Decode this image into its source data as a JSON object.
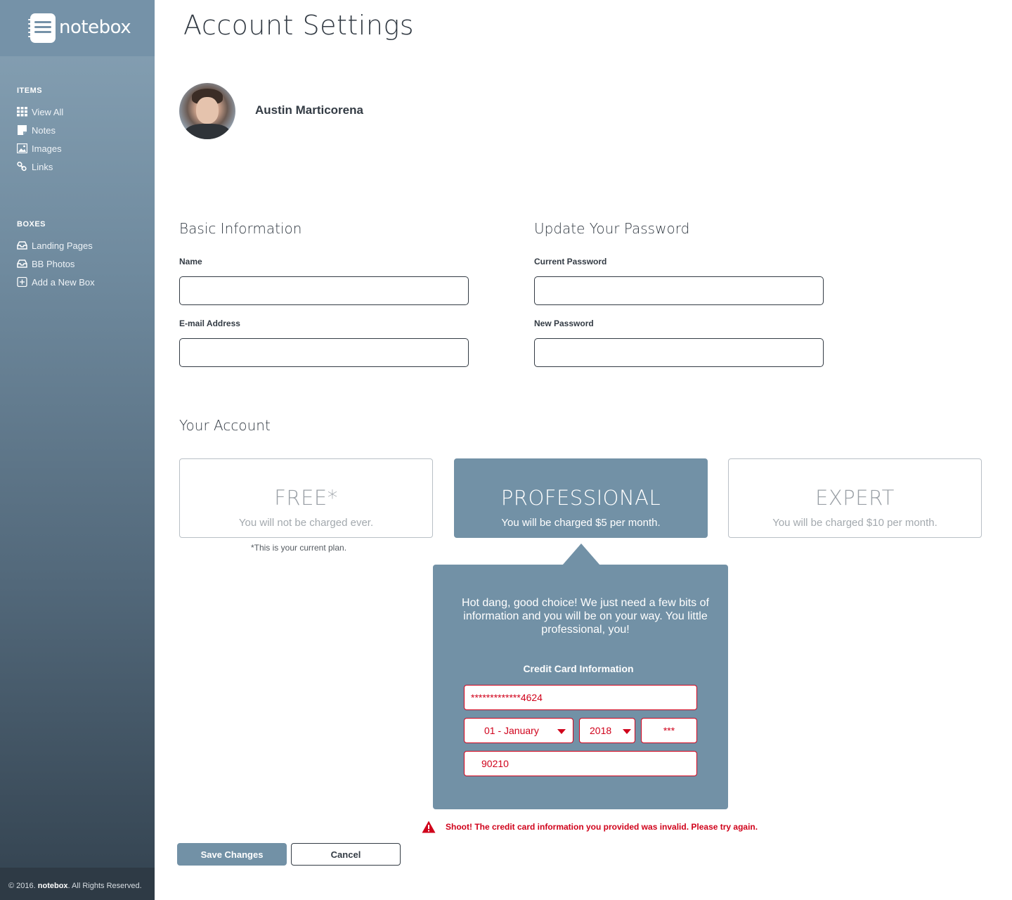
{
  "app": {
    "logo_text": "notebox",
    "page_title": "Account Settings"
  },
  "sidebar": {
    "items_heading": "ITEMS",
    "items": [
      {
        "label": "View All",
        "icon": "grid-icon"
      },
      {
        "label": "Notes",
        "icon": "note-icon"
      },
      {
        "label": "Images",
        "icon": "image-icon"
      },
      {
        "label": "Links",
        "icon": "link-icon"
      }
    ],
    "boxes_heading": "BOXES",
    "boxes": [
      {
        "label": "Landing Pages",
        "icon": "inbox-icon"
      },
      {
        "label": "BB Photos",
        "icon": "inbox-icon"
      },
      {
        "label": "Add a New Box",
        "icon": "plus-square-icon"
      }
    ],
    "footer": {
      "prefix": "© 2016.",
      "brand": "notebox",
      "suffix": ". All Rights Reserved."
    }
  },
  "profile": {
    "name": "Austin Marticorena"
  },
  "basic_info": {
    "title": "Basic Information",
    "name_label": "Name",
    "name_value": "",
    "email_label": "E-mail Address",
    "email_value": ""
  },
  "password": {
    "title": "Update Your Password",
    "current_label": "Current Password",
    "current_value": "",
    "new_label": "New Password",
    "new_value": ""
  },
  "account": {
    "title": "Your Account",
    "plans": [
      {
        "name": "FREE*",
        "description": "You will not be charged ever.",
        "selected": false
      },
      {
        "name": "PROFESSIONAL",
        "description": "You will be charged $5 per month.",
        "selected": true
      },
      {
        "name": "EXPERT",
        "description": "You will be charged $10 per month.",
        "selected": false
      }
    ],
    "current_plan_note": "*This is your current plan."
  },
  "payment_popup": {
    "message": "Hot dang, good choice! We just need a few bits of information and you will be on your way. You little professional, you!",
    "title": "Credit Card Information",
    "card_number": "*************4624",
    "expiry_month": "01 - January",
    "expiry_year": "2018",
    "cvv": "***",
    "zip": "90210"
  },
  "error": {
    "icon": "warning-icon",
    "message": "Shoot! The credit card information you provided was invalid. Please try again."
  },
  "actions": {
    "save_label": "Save Changes",
    "cancel_label": "Cancel"
  },
  "colors": {
    "accent": "#7291a6",
    "error": "#d0021b",
    "text": "#333b44"
  }
}
